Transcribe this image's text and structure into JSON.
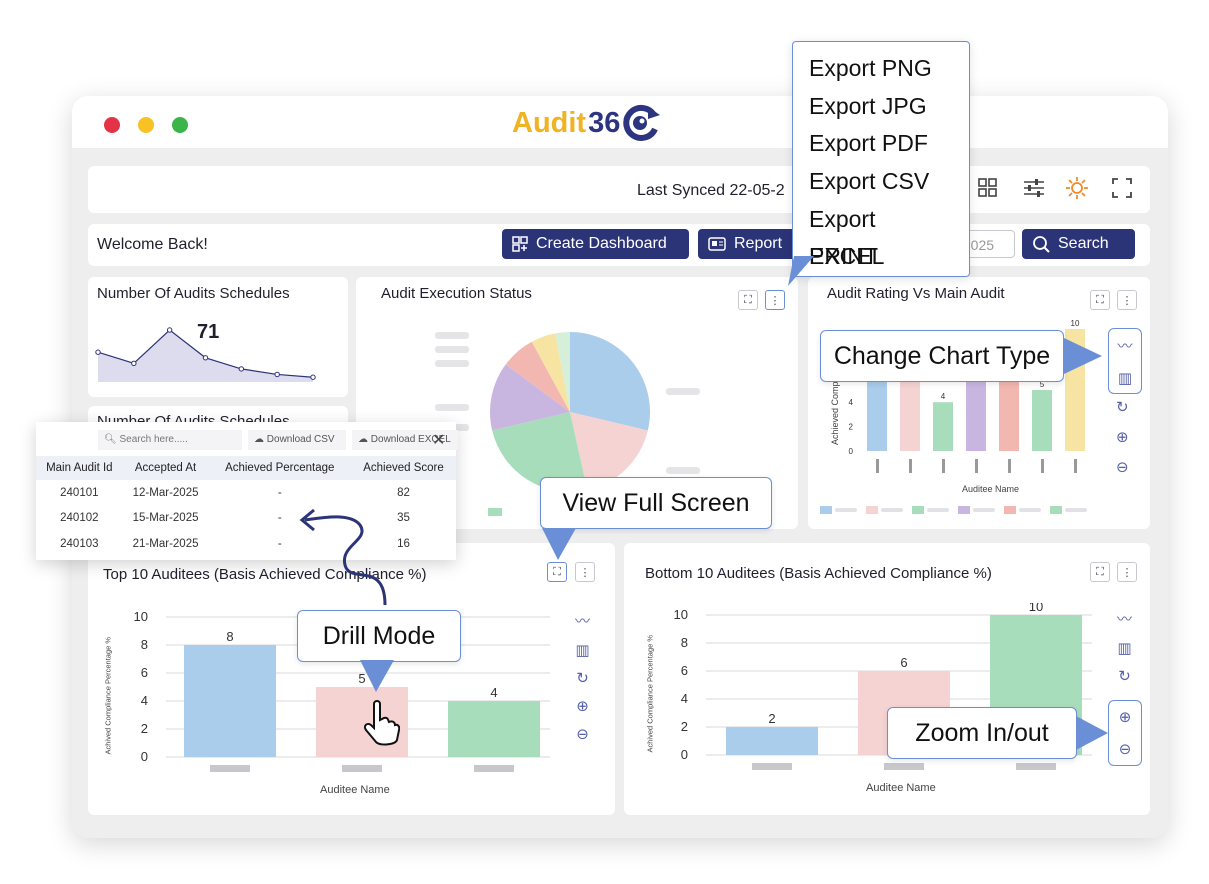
{
  "app": {
    "logo_text_a": "Audit",
    "logo_text_b": "36",
    "logo_icon": "refresh-eye-icon"
  },
  "topbar": {
    "last_synced": "Last Synced 22-05-2",
    "icons": [
      "grid-add-icon",
      "sliders-icon",
      "sun-icon",
      "fullscreen-icon"
    ]
  },
  "actionbar": {
    "welcome": "Welcome Back!",
    "create_dashboard": "Create Dashboard",
    "report": "Report",
    "date_value": "/2025",
    "search": "Search"
  },
  "export_menu": {
    "items": [
      "Export PNG",
      "Export JPG",
      "Export PDF",
      "Export CSV",
      "Export EXCEL",
      "PRINT"
    ]
  },
  "callouts": {
    "change_chart_type": "Change Chart Type",
    "view_full_screen": "View Full Screen",
    "drill_mode": "Drill Mode",
    "zoom": "Zoom In/out"
  },
  "widgets": {
    "audits_schedules": {
      "title": "Number Of Audits Schedules",
      "value": "71"
    },
    "audits_schedules_2": {
      "title": "Number Of Audits Schedules"
    },
    "execution_status": {
      "title": "Audit Execution Status"
    },
    "rating_vs_main": {
      "title": "Audit Rating Vs Main Audit",
      "ylabel": "Achieved Compliance",
      "xlabel": "Auditee Name",
      "visible_labels": [
        "10",
        "4",
        "5",
        "10"
      ],
      "ticks": [
        "6",
        "4",
        "2",
        "0"
      ]
    },
    "top10": {
      "title": "Top 10 Auditees (Basis Achieved Compliance %)",
      "ylabel": "Achived Compliance Percentage %",
      "xlabel": "Auditee Name"
    },
    "bottom10": {
      "title": "Bottom 10 Auditees (Basis Achieved Compliance %)",
      "ylabel": "Achived Compliance Percentage %",
      "xlabel": "Auditee Name"
    }
  },
  "drill_table": {
    "search_placeholder": "Search here.....",
    "download_csv": "Download CSV",
    "download_excel": "Download EXCEL",
    "headers": [
      "Main Audit Id",
      "Accepted At",
      "Achieved Percentage",
      "Achieved Score"
    ],
    "rows": [
      [
        "240101",
        "12-Mar-2025",
        "-",
        "82"
      ],
      [
        "240102",
        "15-Mar-2025",
        "-",
        "35"
      ],
      [
        "240103",
        "21-Mar-2025",
        "-",
        "16"
      ]
    ]
  },
  "chart_data": [
    {
      "type": "line",
      "title": "Number Of Audits Schedules",
      "values": [
        10,
        6,
        18,
        8,
        4,
        2,
        1
      ]
    },
    {
      "type": "pie",
      "title": "Audit Execution Status",
      "values": [
        29,
        18,
        25,
        14,
        7,
        5,
        3
      ],
      "colors": [
        "#aacdeb",
        "#f5d3d3",
        "#a8ddbb",
        "#c9b6e0",
        "#f2b7b0",
        "#f7e4a2",
        "#d6efd9"
      ]
    },
    {
      "type": "bar",
      "title": "Audit Rating Vs Main Audit",
      "ylabel": "Achieved Compliance",
      "xlabel": "Auditee Name",
      "values": [
        8,
        8,
        4,
        8,
        8,
        5,
        10
      ],
      "colors": [
        "#aacdeb",
        "#f5d3d3",
        "#a8ddbb",
        "#c9b6e0",
        "#f2b7b0",
        "#a8ddbb",
        "#f7e4a2"
      ]
    },
    {
      "type": "bar",
      "title": "Top 10 Auditees (Basis Achieved Compliance %)",
      "ylabel": "Achived Compliance Percentage %",
      "xlabel": "Auditee Name",
      "values": [
        8,
        5,
        4
      ],
      "colors": [
        "#aacdeb",
        "#f5d3d3",
        "#a8ddbb"
      ],
      "ylim": [
        0,
        10
      ],
      "ticks": [
        "10",
        "8",
        "6",
        "4",
        "2",
        "0"
      ]
    },
    {
      "type": "bar",
      "title": "Bottom 10 Auditees (Basis Achieved Compliance %)",
      "ylabel": "Achived Compliance Percentage %",
      "xlabel": "Auditee Name",
      "values": [
        2,
        6,
        10
      ],
      "colors": [
        "#aacdeb",
        "#f5d3d3",
        "#a8ddbb"
      ],
      "ylim": [
        0,
        10
      ],
      "ticks": [
        "10",
        "8",
        "6",
        "4",
        "2",
        "0"
      ]
    }
  ]
}
